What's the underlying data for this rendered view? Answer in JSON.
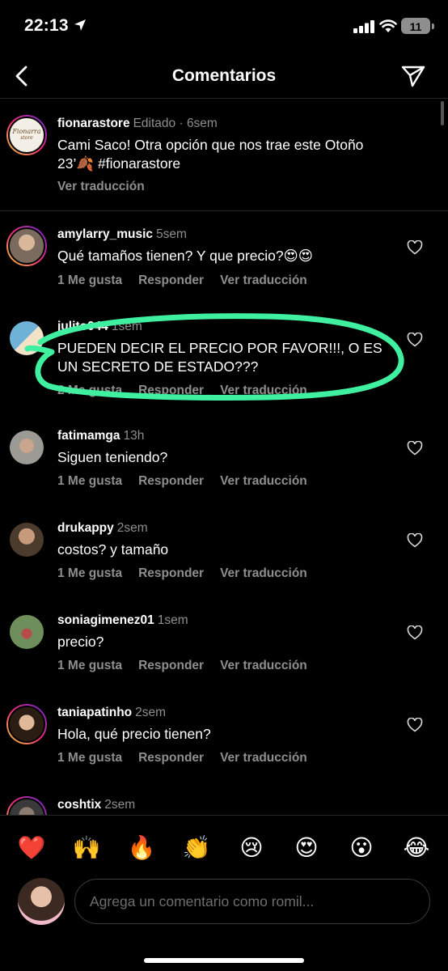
{
  "status": {
    "time": "22:13",
    "battery": "11"
  },
  "header": {
    "title": "Comentarios"
  },
  "caption": {
    "username": "fionarastore",
    "meta": "Editado · 6sem",
    "text": "Cami Saco! Otra opción que nos trae este Otoño 23’🍂 #fionarastore",
    "translate": "Ver traducción",
    "avatar_text_top": "Fionarra",
    "avatar_text_bottom": "store"
  },
  "comments": [
    {
      "username": "amylarry_music",
      "meta": "5sem",
      "text": "Qué tamaños tienen? Y que precio?😍😍",
      "likes": "1 Me gusta",
      "reply": "Responder",
      "translate": "Ver traducción"
    },
    {
      "username": "julito044",
      "meta": "1sem",
      "text": "PUEDEN DECIR EL PRECIO POR FAVOR!!!, O ES UN SECRETO DE ESTADO???",
      "likes": "2 Me gusta",
      "reply": "Responder",
      "translate": "Ver traducción"
    },
    {
      "username": "fatimamga",
      "meta": "13h",
      "text": "Siguen teniendo?",
      "likes": "1 Me gusta",
      "reply": "Responder",
      "translate": "Ver traducción"
    },
    {
      "username": "drukappy",
      "meta": "2sem",
      "text": "costos? y tamaño",
      "likes": "1 Me gusta",
      "reply": "Responder",
      "translate": "Ver traducción"
    },
    {
      "username": "soniagimenez01",
      "meta": "1sem",
      "text": "precio?",
      "likes": "1 Me gusta",
      "reply": "Responder",
      "translate": "Ver traducción"
    },
    {
      "username": "taniapatinho",
      "meta": "2sem",
      "text": "Hola, qué precio tienen?",
      "likes": "1 Me gusta",
      "reply": "Responder",
      "translate": "Ver traducción"
    },
    {
      "username": "coshtix",
      "meta": "2sem"
    }
  ],
  "reactions": [
    "❤️",
    "🙌",
    "🔥",
    "👏",
    "😢",
    "😍",
    "😮",
    "😂"
  ],
  "composer": {
    "placeholder": "Agrega un comentario como romil..."
  },
  "colors": {
    "background": "#000000",
    "muted_text": "#8e8e8e",
    "highlight": "#3ef0a0"
  },
  "icons": [
    "back-arrow-icon",
    "send-icon",
    "heart-outline-icon",
    "location-arrow-icon",
    "signal-icon",
    "wifi-icon"
  ]
}
